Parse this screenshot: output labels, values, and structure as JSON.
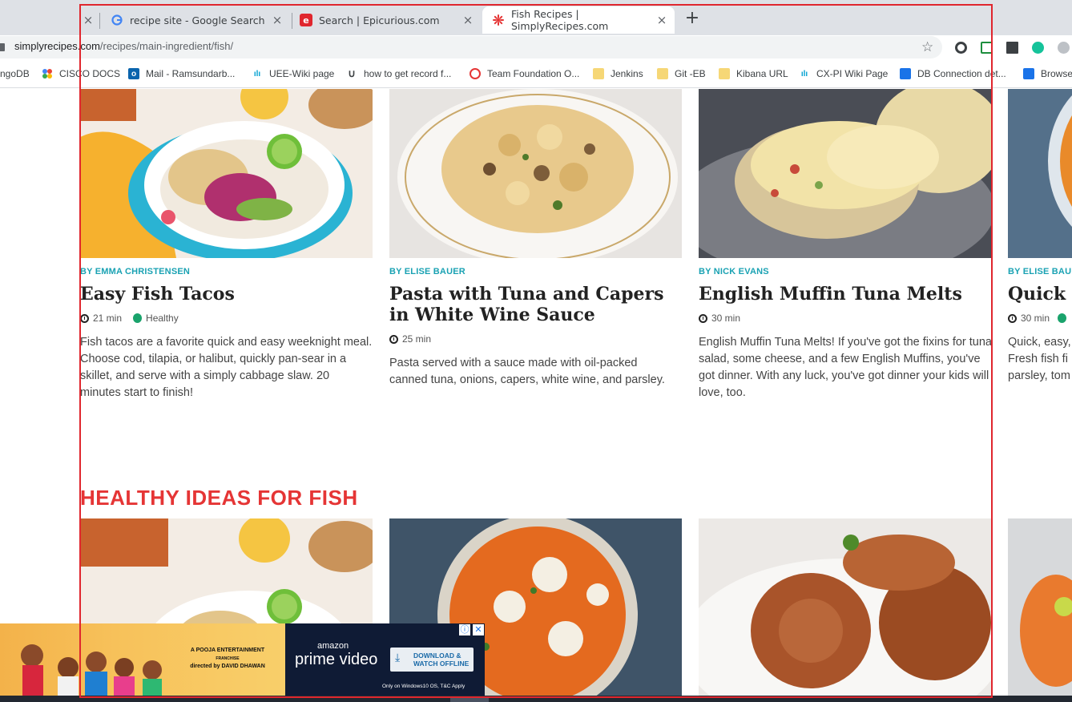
{
  "browser": {
    "tabs": [
      {
        "label": "recipe site - Google Search"
      },
      {
        "label": "Search | Epicurious.com"
      },
      {
        "label": "Fish Recipes | SimplyRecipes.com"
      }
    ],
    "close_glyph": "×",
    "new_tab_glyph": "+",
    "url_domain": "simplyrecipes.com",
    "url_path": "/recipes/main-ingredient/fish/",
    "star_glyph": "☆",
    "bookmarks": [
      {
        "label": "ngoDB"
      },
      {
        "label": "CISCO DOCS"
      },
      {
        "label": "Mail - Ramsundarb..."
      },
      {
        "label": "UEE-Wiki page"
      },
      {
        "label": "how to get record f..."
      },
      {
        "label": "Team Foundation O..."
      },
      {
        "label": "Jenkins"
      },
      {
        "label": "Git -EB"
      },
      {
        "label": "Kibana URL"
      },
      {
        "label": "CX-PI Wiki Page"
      },
      {
        "label": "DB Connection det..."
      },
      {
        "label": "Browse"
      }
    ]
  },
  "recipes": [
    {
      "byline": "BY EMMA CHRISTENSEN",
      "title": "Easy Fish Tacos",
      "time": "21 min",
      "tag": "Healthy",
      "description": "Fish tacos are a favorite quick and easy weeknight meal. Choose cod, tilapia, or halibut, quickly pan-sear in a skillet, and serve with a simply cabbage slaw. 20 minutes start to finish!"
    },
    {
      "byline": "BY ELISE BAUER",
      "title": "Pasta with Tuna and Capers in White Wine Sauce",
      "time": "25 min",
      "description": "Pasta served with a sauce made with oil-packed canned tuna, onions, capers, white wine, and parsley."
    },
    {
      "byline": "BY NICK EVANS",
      "title": "English Muffin Tuna Melts",
      "time": "30 min",
      "description": "English Muffin Tuna Melts! If you've got the fixins for tuna salad, some cheese, and a few English Muffins, you've got dinner. With any luck, you've got dinner your kids will love, too."
    },
    {
      "byline": "BY ELISE BAUE",
      "title": "Quick E",
      "time": "30 min",
      "description_lines": [
        "Quick, easy,",
        "Fresh fish fi",
        "parsley, tom"
      ]
    }
  ],
  "section_heading": "HEALTHY IDEAS FOR FISH",
  "ad": {
    "pooja_line1": "A POOJA ENTERTAINMENT",
    "pooja_line2": "FRANCHISE",
    "pooja_line3": "directed by DAVID DHAWAN",
    "amazon": "amazon",
    "prime": "prime video",
    "download_line1": "DOWNLOAD &",
    "download_line2": "WATCH OFFLINE",
    "only_on": "Only on Windows10 OS, T&C Apply"
  },
  "colors": {
    "accent_red": "#e53535",
    "byline_teal": "#1aa2b3",
    "highlight_box": "#e0262e"
  }
}
